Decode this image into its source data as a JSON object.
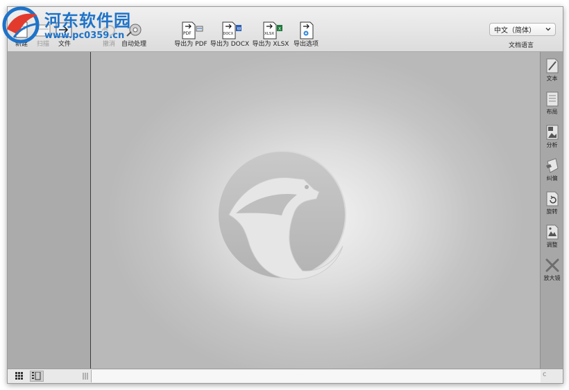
{
  "toolbar": {
    "new_label": "新建",
    "scan_label": "扫描",
    "file_label": "文件",
    "undo_label": "撤消",
    "auto_label": "自动处理",
    "export_pdf_label": "导出为 PDF",
    "export_docx_label": "导出为 DOCX",
    "export_xlsx_label": "导出为 XLSX",
    "export_options_label": "导出选项",
    "pdf_badge": "PDF",
    "docx_badge": "DOCX",
    "xlsx_badge": "XLSX",
    "word_badge": "W",
    "excel_badge": "X"
  },
  "language": {
    "selected": "中文（简体）",
    "caption": "文档语言"
  },
  "right_tools": [
    {
      "label": "文本",
      "icon": "text-pencil-icon"
    },
    {
      "label": "布局",
      "icon": "layout-icon"
    },
    {
      "label": "分析",
      "icon": "analyze-icon"
    },
    {
      "label": "纠偏",
      "icon": "deskew-icon"
    },
    {
      "label": "旋转",
      "icon": "rotate-icon"
    },
    {
      "label": "调整",
      "icon": "adjust-icon"
    },
    {
      "label": "放大镜",
      "icon": "magnifier-icon"
    }
  ],
  "status": {
    "corner_glyph": "c"
  },
  "watermark": {
    "site_name": "河东软件园",
    "site_url": "www.pc0359.cn"
  },
  "colors": {
    "watermark_blue": "#1e73c8",
    "toolbar_bg": "#e6e6e6",
    "sidebar_bg": "#ababab",
    "logo_gray": "#bdbdbd"
  }
}
